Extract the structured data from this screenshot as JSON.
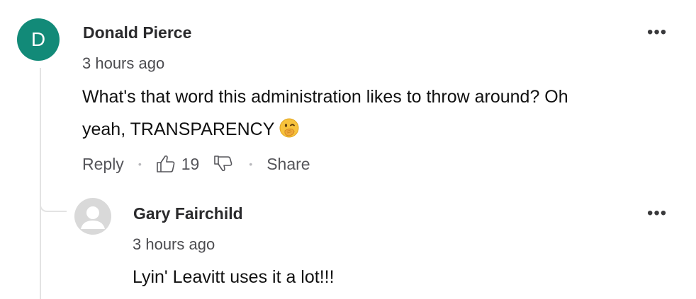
{
  "comment": {
    "avatar_initial": "D",
    "avatar_color": "#128a78",
    "author": "Donald Pierce",
    "time": "3 hours ago",
    "text_line1": "What's that word this administration likes to throw around? Oh",
    "text_line2": "yeah, TRANSPARENCY",
    "emoji": "face-with-hand-over-mouth",
    "more_label": "•••",
    "actions": {
      "reply_label": "Reply",
      "like_count": "19",
      "share_label": "Share",
      "separator": "•"
    }
  },
  "reply": {
    "author": "Gary Fairchild",
    "time": "3 hours ago",
    "text": "Lyin' Leavitt uses it a lot!!!",
    "more_label": "•••"
  }
}
